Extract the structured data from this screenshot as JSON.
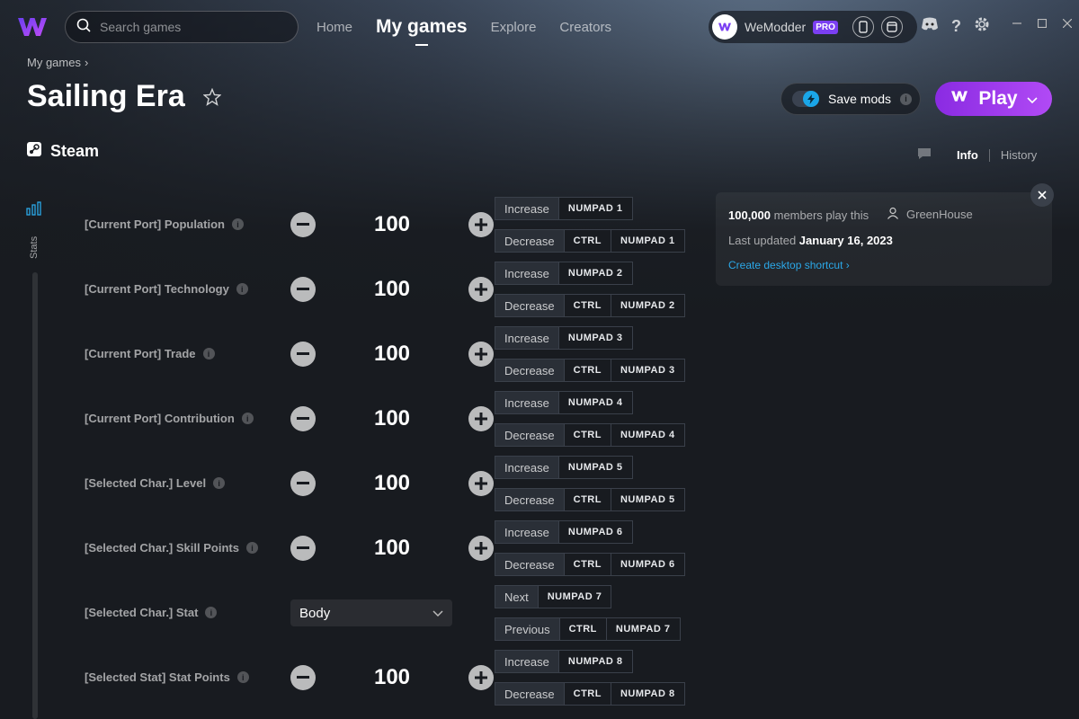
{
  "search": {
    "placeholder": "Search games"
  },
  "nav": {
    "home": "Home",
    "my_games": "My games",
    "explore": "Explore",
    "creators": "Creators"
  },
  "account": {
    "name": "WeModder",
    "badge": "PRO"
  },
  "breadcrumb": {
    "label": "My games"
  },
  "game": {
    "title": "Sailing Era",
    "platform": "Steam"
  },
  "actions": {
    "save_mods": "Save mods",
    "play": "Play"
  },
  "tabs": {
    "info": "Info",
    "history": "History"
  },
  "rail": {
    "stats_label": "Stats"
  },
  "panel": {
    "members_count": "100,000",
    "members_suffix": " members play this",
    "author": "GreenHouse",
    "updated_prefix": "Last updated ",
    "updated_date": "January 16, 2023",
    "shortcut": "Create desktop shortcut"
  },
  "mods": [
    {
      "name": "[Current Port] Population",
      "value": "100"
    },
    {
      "name": "[Current Port] Technology",
      "value": "100"
    },
    {
      "name": "[Current Port] Trade",
      "value": "100"
    },
    {
      "name": "[Current Port] Contribution",
      "value": "100"
    },
    {
      "name": "[Selected Char.] Level",
      "value": "100"
    },
    {
      "name": "[Selected Char.] Skill Points",
      "value": "100"
    },
    {
      "name": "[Selected Char.] Stat",
      "value": "Body"
    },
    {
      "name": "[Selected Stat] Stat Points",
      "value": "100"
    }
  ],
  "hotkeys": [
    {
      "action": "Increase",
      "keys": [
        "NUMPAD 1"
      ]
    },
    {
      "action": "Decrease",
      "keys": [
        "CTRL",
        "NUMPAD 1"
      ]
    },
    {
      "action": "Increase",
      "keys": [
        "NUMPAD 2"
      ]
    },
    {
      "action": "Decrease",
      "keys": [
        "CTRL",
        "NUMPAD 2"
      ]
    },
    {
      "action": "Increase",
      "keys": [
        "NUMPAD 3"
      ]
    },
    {
      "action": "Decrease",
      "keys": [
        "CTRL",
        "NUMPAD 3"
      ]
    },
    {
      "action": "Increase",
      "keys": [
        "NUMPAD 4"
      ]
    },
    {
      "action": "Decrease",
      "keys": [
        "CTRL",
        "NUMPAD 4"
      ]
    },
    {
      "action": "Increase",
      "keys": [
        "NUMPAD 5"
      ]
    },
    {
      "action": "Decrease",
      "keys": [
        "CTRL",
        "NUMPAD 5"
      ]
    },
    {
      "action": "Increase",
      "keys": [
        "NUMPAD 6"
      ]
    },
    {
      "action": "Decrease",
      "keys": [
        "CTRL",
        "NUMPAD 6"
      ]
    },
    {
      "action": "Next",
      "keys": [
        "NUMPAD 7"
      ]
    },
    {
      "action": "Previous",
      "keys": [
        "CTRL",
        "NUMPAD 7"
      ]
    },
    {
      "action": "Increase",
      "keys": [
        "NUMPAD 8"
      ]
    },
    {
      "action": "Decrease",
      "keys": [
        "CTRL",
        "NUMPAD 8"
      ]
    }
  ],
  "colors": {
    "accent": "#b14af5",
    "link": "#2ba8e8",
    "background": "#181b20"
  }
}
